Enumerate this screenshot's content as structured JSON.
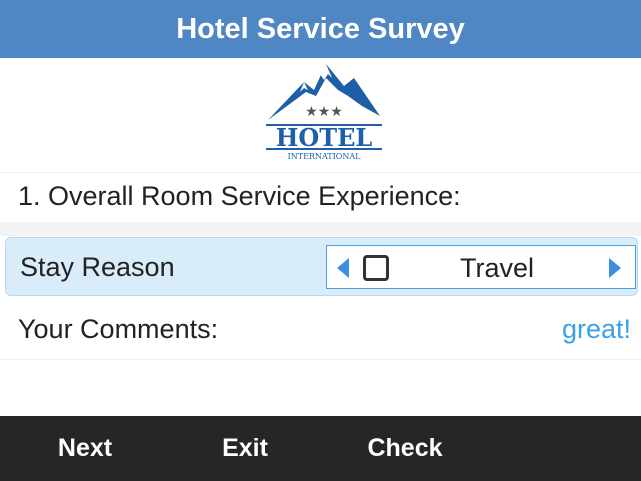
{
  "header": {
    "title": "Hotel Service Survey",
    "color": "#4f86c4"
  },
  "logo": {
    "icon": "hotel-mountain-logo",
    "text_main": "HOTEL",
    "text_sub": "INTERNATIONAL",
    "stars": "★★★",
    "color": "#1f5ea8"
  },
  "question": {
    "label": "1. Overall Room Service Experience:"
  },
  "stay_reason": {
    "label": "Stay Reason",
    "value": "Travel",
    "checked": false,
    "highlight_color": "#d9ecf9",
    "arrow_color": "#3c8fdc"
  },
  "comments": {
    "label": "Your Comments:",
    "value": "great!",
    "value_color": "#3aa0e8"
  },
  "softkeys": [
    {
      "label": "Next"
    },
    {
      "label": "Exit"
    },
    {
      "label": "Check"
    }
  ]
}
